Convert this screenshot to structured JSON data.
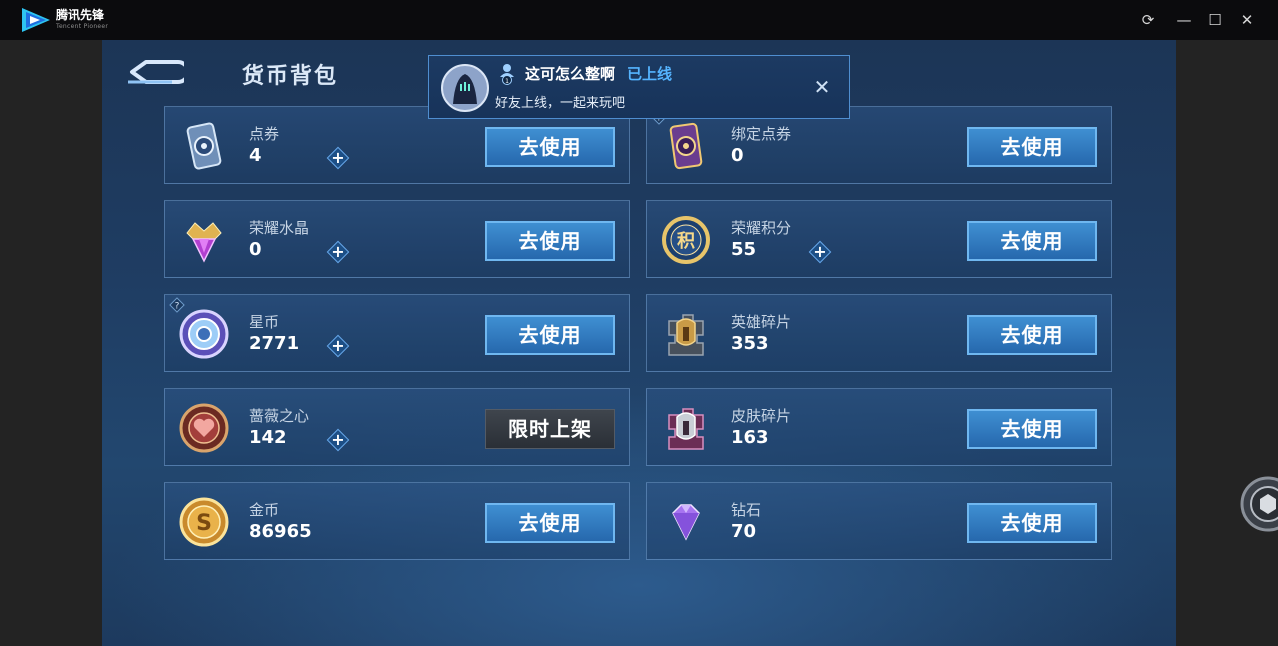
{
  "app": {
    "brand": "腾讯先锋",
    "brand_sub": "Tencent Pioneer"
  },
  "window_controls": {
    "refresh": "⟳",
    "minimize": "—",
    "maximize": "☐",
    "close": "✕"
  },
  "page": {
    "title": "货币背包"
  },
  "notification": {
    "name": "这可怎么整啊",
    "status": "已上线",
    "message": "好友上线，一起来玩吧",
    "user_count": "1",
    "close": "✕"
  },
  "items": [
    {
      "name": "点券",
      "value": "4",
      "icon": "coupon-icon",
      "button": "去使用"
    },
    {
      "name": "绑定点券",
      "value": "0",
      "icon": "bound-coupon-icon",
      "button": "去使用"
    },
    {
      "name": "荣耀水晶",
      "value": "0",
      "icon": "glory-crystal-icon",
      "button": "去使用"
    },
    {
      "name": "荣耀积分",
      "value": "55",
      "icon": "glory-points-icon",
      "button": "去使用",
      "icon_text": "积"
    },
    {
      "name": "星币",
      "value": "2771",
      "icon": "star-coin-icon",
      "button": "去使用"
    },
    {
      "name": "英雄碎片",
      "value": "353",
      "icon": "hero-shard-icon",
      "button": "去使用"
    },
    {
      "name": "蔷薇之心",
      "value": "142",
      "icon": "rose-heart-icon",
      "button": "限时上架"
    },
    {
      "name": "皮肤碎片",
      "value": "163",
      "icon": "skin-shard-icon",
      "button": "去使用"
    },
    {
      "name": "金币",
      "value": "86965",
      "icon": "gold-coin-icon",
      "button": "去使用",
      "icon_text": "S"
    },
    {
      "name": "钻石",
      "value": "70",
      "icon": "diamond-icon",
      "button": "去使用"
    }
  ],
  "colors": {
    "accent": "#3f8fd2",
    "online": "#55b4ff",
    "card_border": "#82afe1"
  }
}
